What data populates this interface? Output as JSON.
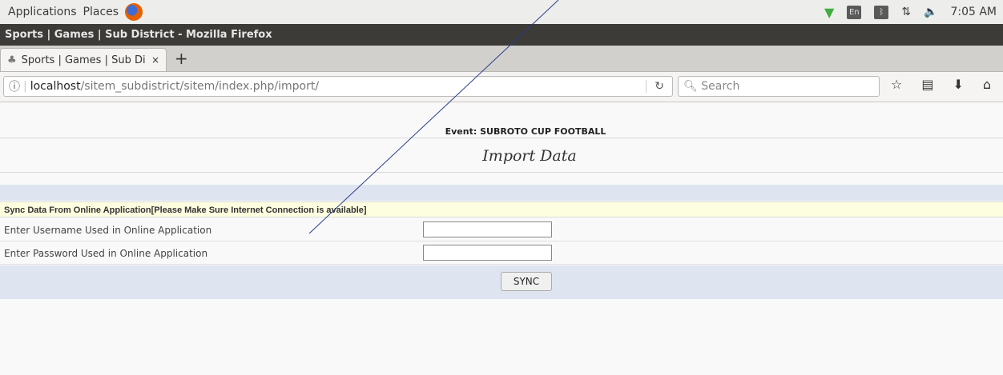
{
  "topbar": {
    "applications": "Applications",
    "places": "Places",
    "keyboard": "En",
    "clock": "7:05 AM"
  },
  "window": {
    "title": "Sports | Games | Sub District - Mozilla Firefox"
  },
  "tab": {
    "label": "Sports | Games | Sub Di",
    "close": "×",
    "new_tab": "+"
  },
  "navbar": {
    "url_host": "localhost",
    "url_path": "/sitem_subdistrict/sitem/index.php/import/",
    "search_placeholder": "Search"
  },
  "page": {
    "event": "Event: SUBROTO CUP FOOTBALL",
    "heading": "Import Data",
    "notice": "Sync Data From Online Application[Please Make Sure Internet Connection is available]",
    "username_label": "Enter Username Used in Online Application",
    "password_label": "Enter Password Used in Online Application",
    "username_value": "",
    "password_value": "",
    "sync_button": "SYNC"
  }
}
